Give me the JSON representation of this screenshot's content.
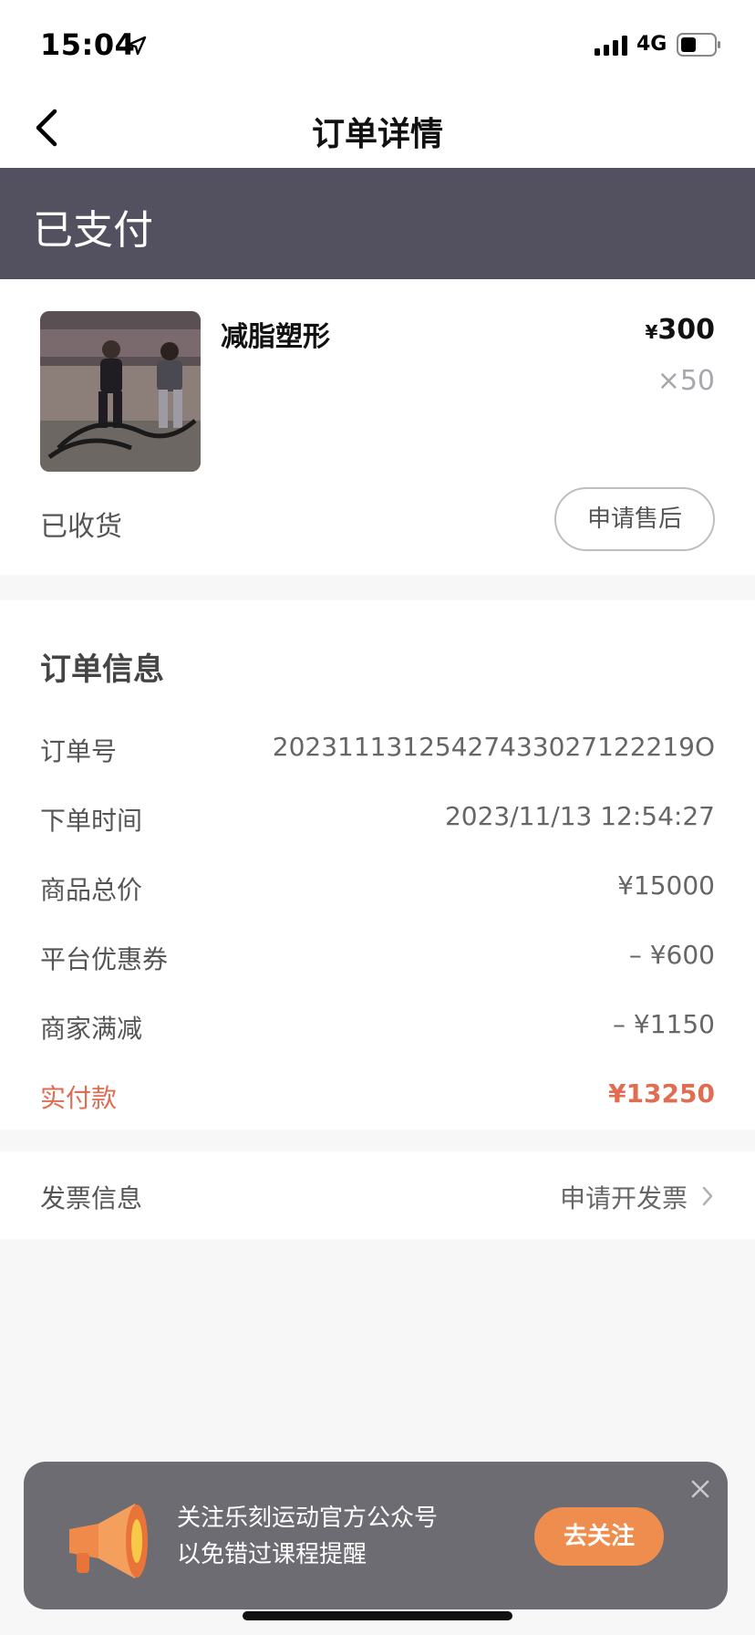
{
  "status_bar": {
    "time": "15:04",
    "network": "4G"
  },
  "nav": {
    "title": "订单详情"
  },
  "order_status": {
    "label": "已支付"
  },
  "product": {
    "name": "减脂塑形",
    "currency": "¥",
    "price": "300",
    "quantity": "×50",
    "delivery_status": "已收货",
    "after_sale_label": "申请售后"
  },
  "order_info": {
    "title": "订单信息",
    "rows": [
      {
        "label": "订单号",
        "value": "20231113125427433027122219O"
      },
      {
        "label": "下单时间",
        "value": "2023/11/13 12:54:27"
      },
      {
        "label": "商品总价",
        "value": "¥15000"
      },
      {
        "label": "平台优惠券",
        "value": "– ¥600"
      },
      {
        "label": "商家满减",
        "value": "– ¥1150"
      },
      {
        "label": "实付款",
        "value": "¥13250"
      }
    ]
  },
  "invoice": {
    "label": "发票信息",
    "action": "申请开发票"
  },
  "follow_banner": {
    "line1": "关注乐刻运动官方公众号",
    "line2": "以免错过课程提醒",
    "button_label": "去关注"
  },
  "colors": {
    "banner_bg": "#53505f",
    "accent_red": "#e06c52",
    "follow_button": "#ee8d4d"
  }
}
